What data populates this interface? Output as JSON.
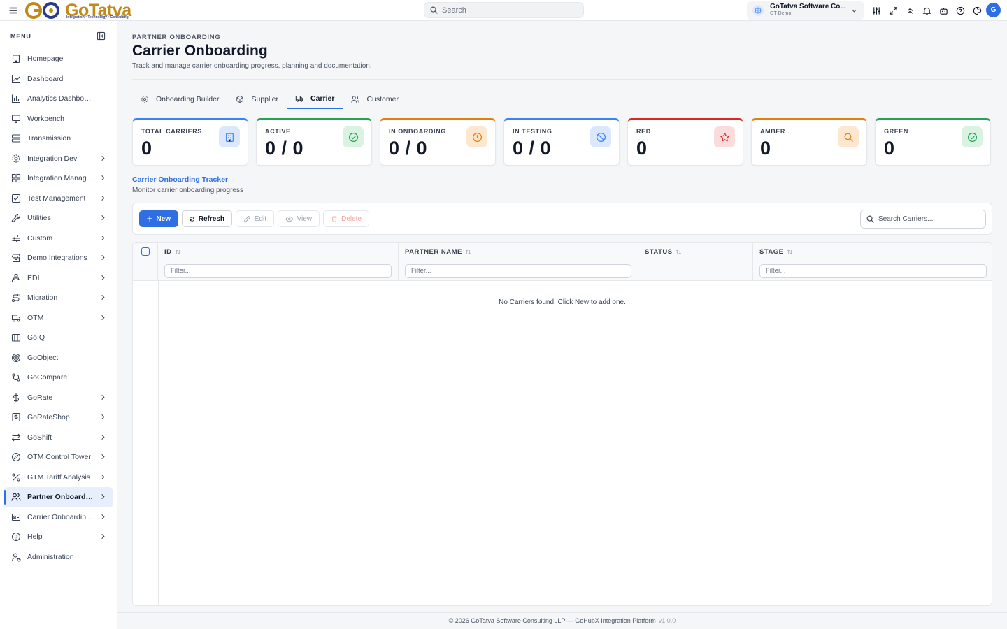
{
  "app": {
    "logo_text": "GoTatva",
    "logo_tagline": "Integration • Technology • Consulting"
  },
  "topbar": {
    "search_placeholder": "Search",
    "org_name": "GoTatva Software Co...",
    "org_sub": "GT-Demo",
    "avatar_initial": "G"
  },
  "sidebar": {
    "menu_label": "MENU",
    "items": [
      {
        "label": "Homepage",
        "icon": "building-icon",
        "chevron": false
      },
      {
        "label": "Dashboard",
        "icon": "line-chart-icon",
        "chevron": false
      },
      {
        "label": "Analytics Dashboard",
        "icon": "bar-chart-icon",
        "chevron": false
      },
      {
        "label": "Workbench",
        "icon": "monitor-icon",
        "chevron": false
      },
      {
        "label": "Transmission",
        "icon": "server-icon",
        "chevron": false
      },
      {
        "label": "Integration Dev",
        "icon": "gear-icon",
        "chevron": true
      },
      {
        "label": "Integration Manag...",
        "icon": "grid-icon",
        "chevron": true
      },
      {
        "label": "Test Management",
        "icon": "check-square-icon",
        "chevron": true
      },
      {
        "label": "Utilities",
        "icon": "wrench-icon",
        "chevron": true
      },
      {
        "label": "Custom",
        "icon": "sliders-icon",
        "chevron": true
      },
      {
        "label": "Demo Integrations",
        "icon": "store-icon",
        "chevron": true
      },
      {
        "label": "EDI",
        "icon": "network-icon",
        "chevron": true
      },
      {
        "label": "Migration",
        "icon": "route-icon",
        "chevron": true
      },
      {
        "label": "OTM",
        "icon": "truck-icon",
        "chevron": true
      },
      {
        "label": "GoIQ",
        "icon": "columns-icon",
        "chevron": false
      },
      {
        "label": "GoObject",
        "icon": "target-icon",
        "chevron": false
      },
      {
        "label": "GoCompare",
        "icon": "git-compare-icon",
        "chevron": false
      },
      {
        "label": "GoRate",
        "icon": "dollar-icon",
        "chevron": true
      },
      {
        "label": "GoRateShop",
        "icon": "receipt-icon",
        "chevron": true
      },
      {
        "label": "GoShift",
        "icon": "arrows-swap-icon",
        "chevron": true
      },
      {
        "label": "OTM Control Tower",
        "icon": "compass-icon",
        "chevron": true
      },
      {
        "label": "GTM Tariff Analysis",
        "icon": "percent-icon",
        "chevron": true
      },
      {
        "label": "Partner Onboardi...",
        "icon": "users-icon",
        "chevron": true,
        "active": true
      },
      {
        "label": "Carrier Onboardin...",
        "icon": "id-card-icon",
        "chevron": true
      },
      {
        "label": "Help",
        "icon": "help-circle-icon",
        "chevron": true
      },
      {
        "label": "Administration",
        "icon": "user-cog-icon",
        "chevron": false
      }
    ]
  },
  "page": {
    "breadcrumb": "PARTNER ONBOARDING",
    "title": "Carrier Onboarding",
    "description": "Track and manage carrier onboarding progress, planning and documentation."
  },
  "tabs": [
    {
      "label": "Onboarding Builder",
      "icon": "gear-icon"
    },
    {
      "label": "Supplier",
      "icon": "package-icon"
    },
    {
      "label": "Carrier",
      "icon": "truck-icon",
      "active": true
    },
    {
      "label": "Customer",
      "icon": "users-icon"
    }
  ],
  "stats": [
    {
      "label": "TOTAL CARRIERS",
      "value": "0",
      "color": "#3b82f6",
      "icon": "building-icon",
      "icon_bg": "#dbe7fb",
      "icon_color": "#3b82f6"
    },
    {
      "label": "ACTIVE",
      "value": "0 / 0",
      "color": "#22a355",
      "icon": "check-circle-icon",
      "icon_bg": "#d9f2e1",
      "icon_color": "#22a355"
    },
    {
      "label": "IN ONBOARDING",
      "value": "0 / 0",
      "color": "#e67e0d",
      "icon": "clock-icon",
      "icon_bg": "#fde7cf",
      "icon_color": "#e67e0d"
    },
    {
      "label": "IN TESTING",
      "value": "0 / 0",
      "color": "#3b82f6",
      "icon": "ban-icon",
      "icon_bg": "#dbe7fb",
      "icon_color": "#3b82f6"
    },
    {
      "label": "RED",
      "value": "0",
      "color": "#dc2626",
      "icon": "star-icon",
      "icon_bg": "#fbdcdc",
      "icon_color": "#dc2626"
    },
    {
      "label": "AMBER",
      "value": "0",
      "color": "#e67e0d",
      "icon": "search-icon",
      "icon_bg": "#fde7cf",
      "icon_color": "#e67e0d"
    },
    {
      "label": "GREEN",
      "value": "0",
      "color": "#22a355",
      "icon": "check-circle-icon",
      "icon_bg": "#d9f2e1",
      "icon_color": "#22a355"
    }
  ],
  "tracker": {
    "title": "Carrier Onboarding Tracker",
    "subtitle": "Monitor carrier onboarding progress"
  },
  "toolbar": {
    "new_label": "New",
    "refresh_label": "Refresh",
    "edit_label": "Edit",
    "view_label": "View",
    "delete_label": "Delete",
    "search_placeholder": "Search Carriers..."
  },
  "table": {
    "columns": [
      "ID",
      "PARTNER NAME",
      "STATUS",
      "STAGE"
    ],
    "filter_placeholder": "Filter...",
    "empty_message": "No Carriers found. Click New to add one."
  },
  "footer": {
    "text": "© 2026 GoTatva Software Consulting LLP — GoHubX Integration Platform",
    "version": "v1.0.0"
  }
}
